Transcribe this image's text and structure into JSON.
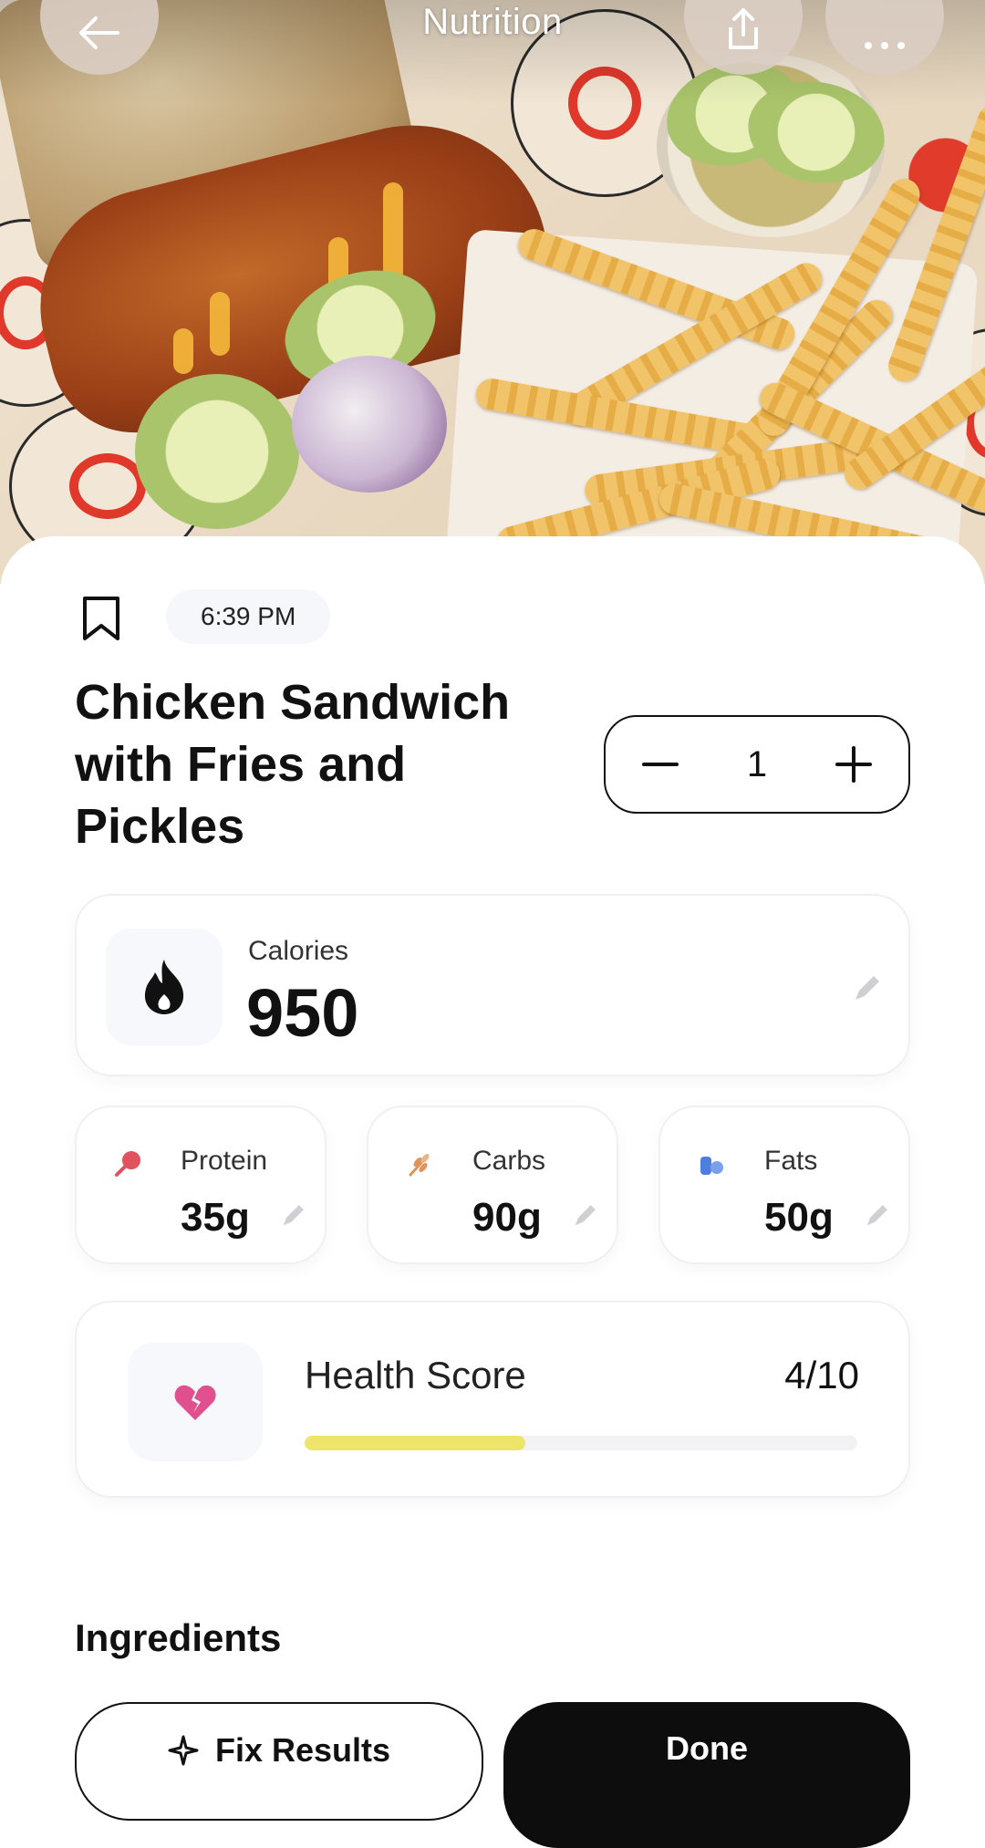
{
  "header": {
    "title": "Nutrition",
    "back_icon": "arrow-left-icon",
    "share_icon": "share-icon",
    "more_icon": "more-horizontal-icon"
  },
  "meal": {
    "time": "6:39 PM",
    "name": "Chicken Sandwich with Fries and Pickles",
    "quantity": "1"
  },
  "calories": {
    "label": "Calories",
    "value": "950",
    "icon": "flame-icon"
  },
  "macros": [
    {
      "label": "Protein",
      "value": "35g",
      "icon": "drumstick-icon",
      "color": "#e0525e"
    },
    {
      "label": "Carbs",
      "value": "90g",
      "icon": "wheat-icon",
      "color": "#e0935a"
    },
    {
      "label": "Fats",
      "value": "50g",
      "icon": "oil-drop-icon",
      "color": "#4f7fdc"
    }
  ],
  "health_score": {
    "label": "Health Score",
    "score_text": "4/10",
    "fraction": 0.4,
    "bar_color": "#ece56a",
    "icon": "broken-heart-icon",
    "icon_color": "#e0508e"
  },
  "sections": {
    "ingredients_title": "Ingredients"
  },
  "actions": {
    "fix_label": "Fix Results",
    "fix_icon": "sparkle-icon",
    "done_label": "Done"
  }
}
